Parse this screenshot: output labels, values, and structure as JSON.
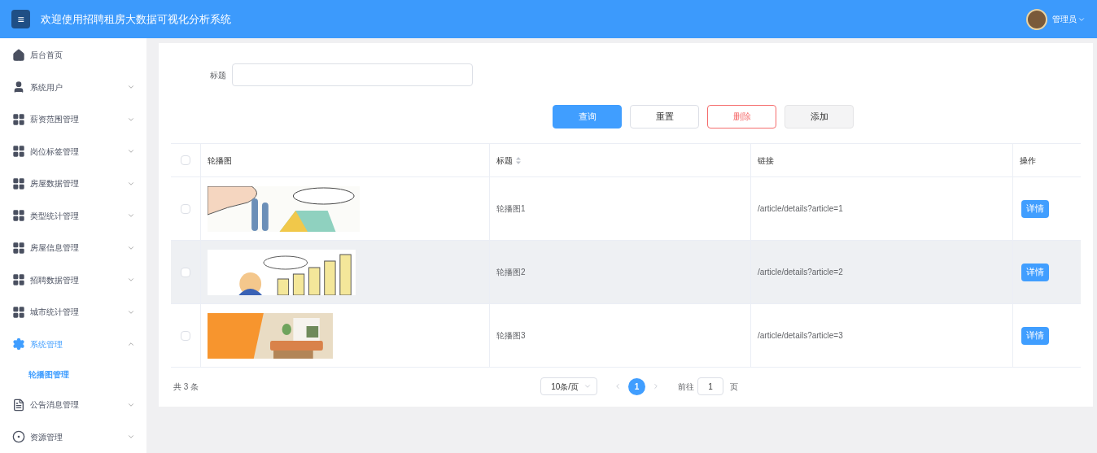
{
  "header": {
    "menu_button": "≡",
    "title": "欢迎使用招聘租房大数据可视化分析系统",
    "user": "管理员"
  },
  "sidebar": {
    "items": [
      {
        "label": "后台首页",
        "kind": "home"
      },
      {
        "label": "系统用户",
        "kind": "user",
        "expanded": false
      },
      {
        "label": "薪资范围管理",
        "kind": "grid",
        "expanded": false
      },
      {
        "label": "岗位标签管理",
        "kind": "grid",
        "expanded": false
      },
      {
        "label": "房屋数据管理",
        "kind": "grid",
        "expanded": false
      },
      {
        "label": "类型统计管理",
        "kind": "grid",
        "expanded": false
      },
      {
        "label": "房屋信息管理",
        "kind": "grid",
        "expanded": false
      },
      {
        "label": "招聘数据管理",
        "kind": "grid",
        "expanded": false
      },
      {
        "label": "城市统计管理",
        "kind": "grid",
        "expanded": false
      },
      {
        "label": "系统管理",
        "kind": "gear",
        "expanded": true,
        "children": [
          {
            "label": "轮播图管理",
            "selected": true
          }
        ]
      },
      {
        "label": "公告消息管理",
        "kind": "doc",
        "expanded": false
      },
      {
        "label": "资源管理",
        "kind": "circle",
        "expanded": false
      }
    ]
  },
  "search": {
    "label": "标题"
  },
  "buttons": [
    {
      "label": "查询",
      "kind": "primary"
    },
    {
      "label": "重置",
      "kind": "default"
    },
    {
      "label": "删除",
      "kind": "danger"
    },
    {
      "label": "添加",
      "kind": "hover"
    }
  ],
  "table": {
    "columns": [
      {
        "label": "轮播图"
      },
      {
        "label": "标题",
        "sortable": true
      },
      {
        "label": "链接"
      },
      {
        "label": "操作"
      }
    ],
    "header_checked": false,
    "rows": [
      {
        "checked": false,
        "hovered": false,
        "title": "轮播图1",
        "link": "/article/details?article=1",
        "action": "详情"
      },
      {
        "checked": false,
        "hovered": true,
        "title": "轮播图2",
        "link": "/article/details?article=2",
        "action": "详情"
      },
      {
        "checked": false,
        "hovered": false,
        "title": "轮播图3",
        "link": "/article/details?article=3",
        "action": "详情"
      }
    ]
  },
  "pagination": {
    "total": "共 3 条",
    "page_size": "10条/页",
    "pages": [
      {
        "label": "1",
        "selected": true
      }
    ],
    "goto_label": "前往",
    "goto_value": "1",
    "goto_suffix": "页"
  }
}
